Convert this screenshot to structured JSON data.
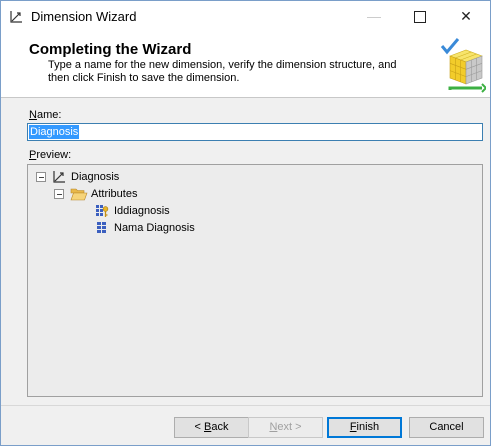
{
  "window": {
    "title": "Dimension Wizard"
  },
  "header": {
    "title": "Completing the Wizard",
    "description": "Type a name for the new dimension, verify the dimension structure, and then click Finish to save the dimension."
  },
  "form": {
    "name_label_prefix": "N",
    "name_label_rest": "ame:",
    "name_value": "Diagnosis",
    "preview_label_prefix": "P",
    "preview_label_rest": "review:"
  },
  "tree": {
    "root": {
      "label": "Diagnosis",
      "icon": "dimension-icon"
    },
    "folder": {
      "label": "Attributes",
      "icon": "folder-open-icon"
    },
    "attributes": [
      {
        "label": "Iddiagnosis",
        "icon": "key-attribute-icon"
      },
      {
        "label": "Nama Diagnosis",
        "icon": "attribute-icon"
      }
    ]
  },
  "buttons": {
    "back_prefix": "< ",
    "back_mnemonic": "B",
    "back_rest": "ack",
    "next_mnemonic": "N",
    "next_rest": "ext >",
    "finish_mnemonic": "F",
    "finish_rest": "inish",
    "cancel": "Cancel"
  },
  "colors": {
    "selection": "#3399ff",
    "focus_border": "#0078d7"
  }
}
